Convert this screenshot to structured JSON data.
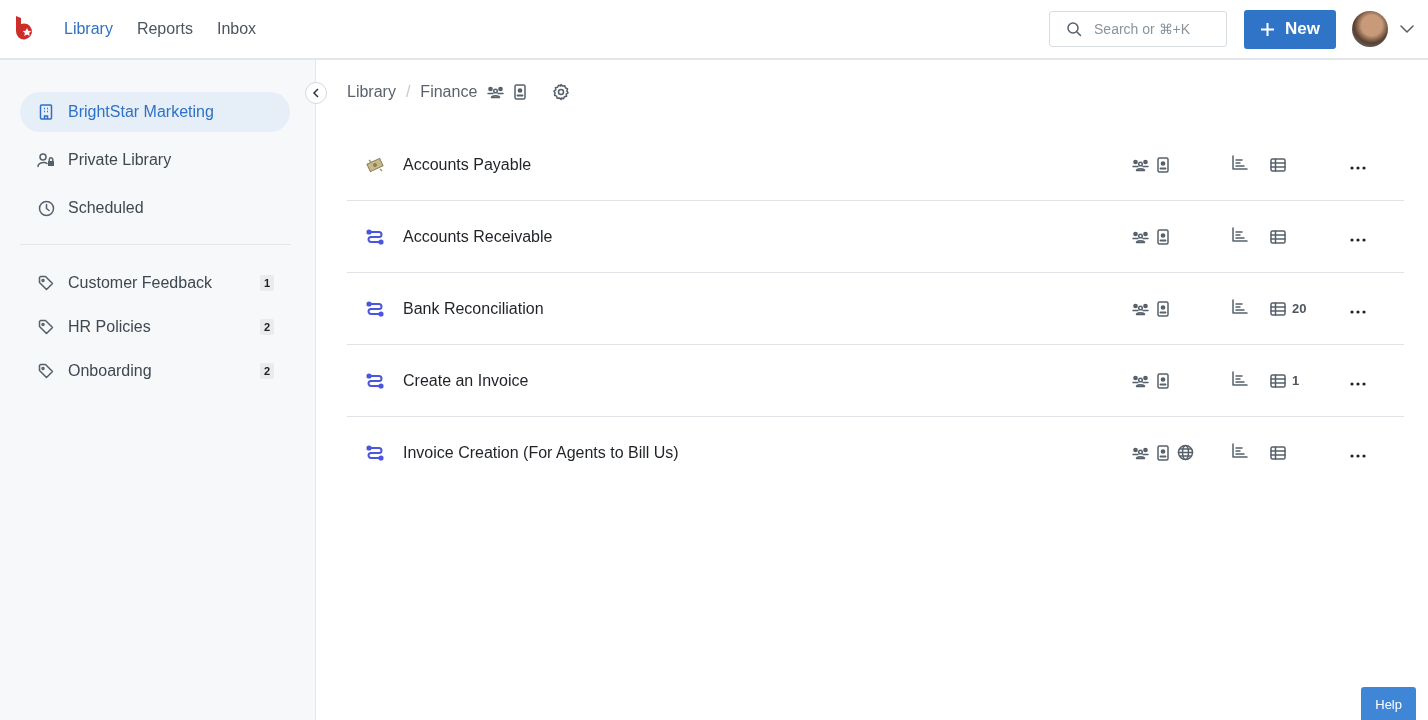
{
  "nav": {
    "tabs": [
      {
        "label": "Library",
        "selected": true
      },
      {
        "label": "Reports",
        "selected": false
      },
      {
        "label": "Inbox",
        "selected": false
      }
    ],
    "search": {
      "placeholder": "Search or ⌘+K"
    },
    "new_button": "New"
  },
  "sidebar": {
    "items": [
      {
        "kind": "workspace",
        "label": "BrightStar Marketing",
        "selected": true
      },
      {
        "kind": "private",
        "label": "Private Library",
        "selected": false
      },
      {
        "kind": "scheduled",
        "label": "Scheduled",
        "selected": false
      }
    ],
    "tags": [
      {
        "label": "Customer Feedback",
        "count": "1"
      },
      {
        "label": "HR Policies",
        "count": "2"
      },
      {
        "label": "Onboarding",
        "count": "2"
      }
    ]
  },
  "breadcrumb": {
    "separator": "/",
    "items": [
      "Library",
      "Finance"
    ]
  },
  "rows": [
    {
      "kind": "money",
      "title": "Accounts Payable",
      "public": false
    },
    {
      "kind": "workflow",
      "title": "Accounts Receivable",
      "public": false
    },
    {
      "kind": "workflow",
      "title": "Bank Reconciliation",
      "public": false,
      "table_count": "20"
    },
    {
      "kind": "workflow",
      "title": "Create an Invoice",
      "public": false,
      "table_count": "1"
    },
    {
      "kind": "workflow",
      "title": "Invoice Creation (For Agents to Bill Us)",
      "public": true
    }
  ],
  "help_button": "Help"
}
